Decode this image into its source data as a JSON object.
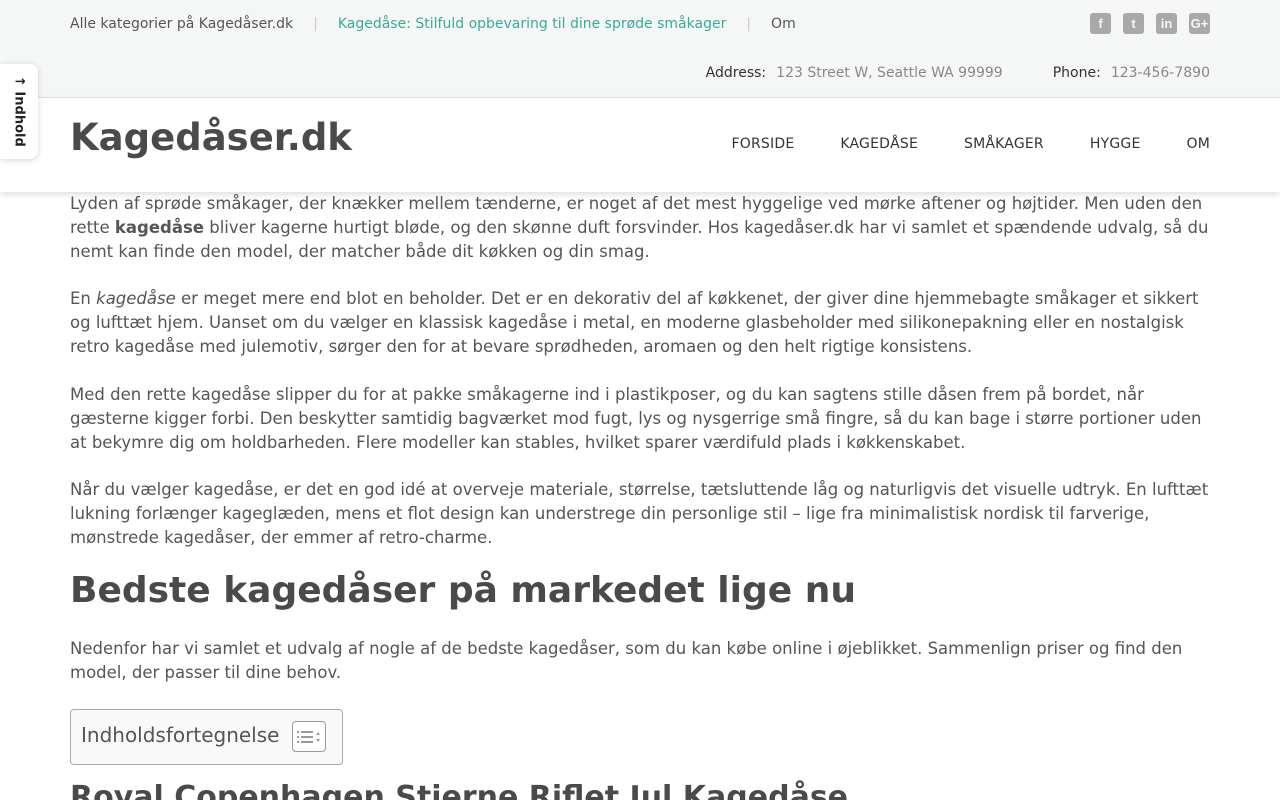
{
  "topbar": {
    "links": [
      {
        "label": "Alle kategorier på Kagedåser.dk"
      },
      {
        "label": "Kagedåse: Stilfuld opbevaring til dine sprøde småkager"
      },
      {
        "label": "Om"
      }
    ],
    "separator": "|",
    "social": [
      {
        "icon": "facebook-icon",
        "glyph": "f"
      },
      {
        "icon": "twitter-icon",
        "glyph": "t"
      },
      {
        "icon": "linkedin-icon",
        "glyph": "in"
      },
      {
        "icon": "google-plus-icon",
        "glyph": "G+"
      }
    ],
    "address_label": "Address:",
    "address_value": "123 Street W, Seattle WA 99999",
    "phone_label": "Phone:",
    "phone_value": "123-456-7890",
    "accent_color": "#3aab96"
  },
  "sidetab": {
    "label": "↑ Indhold"
  },
  "header": {
    "logo": "Kagedåser.dk",
    "nav": [
      "FORSIDE",
      "KAGEDÅSE",
      "SMÅKAGER",
      "HYGGE",
      "OM"
    ]
  },
  "content": {
    "p1_a": "Lyden af sprøde småkager, der knækker mellem tænderne, er noget af det mest hyggelige ved mørke aftener og højtider. Men uden den rette ",
    "p1_b": "kagedåse",
    "p1_c": " bliver kagerne hurtigt bløde, og den skønne duft forsvinder. Hos kagedåser.dk har vi samlet et spændende udvalg, så du nemt kan finde den model, der matcher både dit køkken og din smag.",
    "p2_a": "En ",
    "p2_b": "kagedåse",
    "p2_c": " er meget mere end blot en beholder. Det er en dekorativ del af køkkenet, der giver dine hjemmebagte småkager et sikkert og lufttæt hjem. Uanset om du vælger en klassisk kagedåse i metal, en moderne glasbeholder med silikonepakning eller en nostalgisk retro kagedåse med julemotiv, sørger den for at bevare sprødheden, aromaen og den helt rigtige konsistens.",
    "p3": "Med den rette kagedåse slipper du for at pakke småkagerne ind i plastikposer, og du kan sagtens stille dåsen frem på bordet, når gæsterne kigger forbi. Den beskytter samtidig bagværket mod fugt, lys og nysgerrige små fingre, så du kan bage i større portioner uden at bekymre dig om holdbarheden. Flere modeller kan stables, hvilket sparer værdifuld plads i køkkenskabet.",
    "p4": "Når du vælger kagedåse, er det en god idé at overveje materiale, størrelse, tætsluttende låg og naturligvis det visuelle udtryk. En lufttæt lukning forlænger kageglæden, mens et flot design kan understrege din personlige stil – lige fra minimalistisk nordisk til farverige, mønstrede kagedåser, der emmer af retro-charme.",
    "h2": "Bedste kagedåser på markedet lige nu",
    "p5": "Nedenfor har vi samlet et udvalg af nogle af de bedste kagedåser, som du kan købe online i øjeblikket. Sammenlign priser og find den model, der passer til dine behov.",
    "toc_title": "Indholdsfortegnelse",
    "h3": "Royal Copenhagen Stjerne Riflet Jul Kagedåse"
  }
}
